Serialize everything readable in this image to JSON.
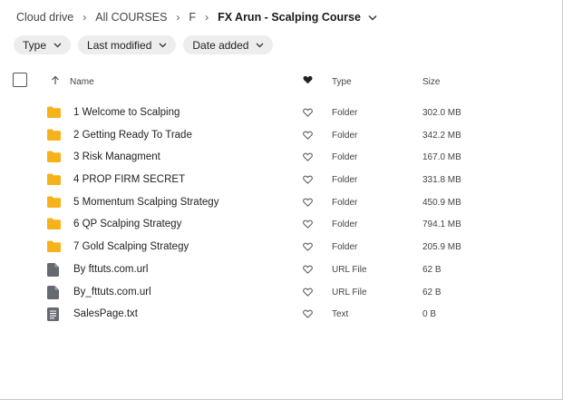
{
  "breadcrumb": {
    "items": [
      "Cloud drive",
      "All COURSES",
      "F"
    ],
    "current": "FX Arun - Scalping Course"
  },
  "filters": [
    {
      "label": "Type"
    },
    {
      "label": "Last modified"
    },
    {
      "label": "Date added"
    }
  ],
  "table": {
    "headers": {
      "name": "Name",
      "type": "Type",
      "size": "Size"
    },
    "rows": [
      {
        "name": "1 Welcome to Scalping",
        "type": "Folder",
        "size": "302.0 MB",
        "icon": "folder-icon"
      },
      {
        "name": "2 Getting Ready To Trade",
        "type": "Folder",
        "size": "342.2 MB",
        "icon": "folder-icon"
      },
      {
        "name": "3 Risk Managment",
        "type": "Folder",
        "size": "167.0 MB",
        "icon": "folder-icon"
      },
      {
        "name": "4 PROP FIRM SECRET",
        "type": "Folder",
        "size": "331.8 MB",
        "icon": "folder-icon"
      },
      {
        "name": "5 Momentum Scalping Strategy",
        "type": "Folder",
        "size": "450.9 MB",
        "icon": "folder-icon"
      },
      {
        "name": "6 QP Scalping Strategy",
        "type": "Folder",
        "size": "794.1 MB",
        "icon": "folder-icon"
      },
      {
        "name": "7 Gold Scalping Strategy",
        "type": "Folder",
        "size": "205.9 MB",
        "icon": "folder-icon"
      },
      {
        "name": "By fttuts.com.url",
        "type": "URL File",
        "size": "62 B",
        "icon": "url-file-icon"
      },
      {
        "name": "By_fttuts.com.url",
        "type": "URL File",
        "size": "62 B",
        "icon": "url-file-icon"
      },
      {
        "name": "SalesPage.txt",
        "type": "Text",
        "size": "0 B",
        "icon": "text-file-icon"
      }
    ]
  },
  "colors": {
    "folder": "#f6b21a",
    "file": "#666a70",
    "chip_bg": "#ededed"
  }
}
